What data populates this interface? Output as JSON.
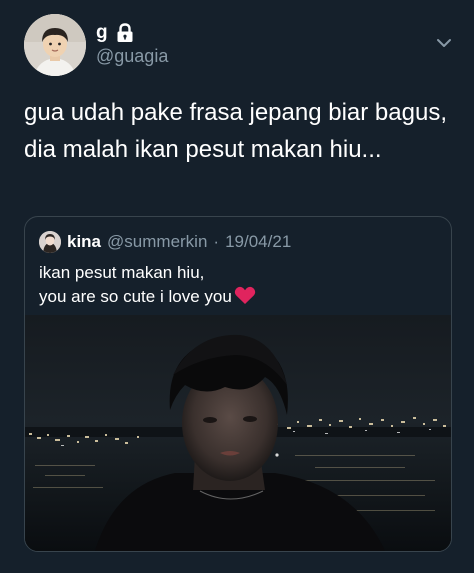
{
  "tweet": {
    "author": {
      "display_name": "g",
      "handle": "@guagia",
      "locked": true,
      "lock_icon": "lock-icon",
      "avatar_icon": "user-avatar"
    },
    "menu_icon": "chevron-down-icon",
    "text": "gua udah pake frasa jepang biar bagus, dia malah ikan pesut makan hiu...",
    "quoted_tweet": {
      "author": {
        "display_name": "kina",
        "handle": "@summerkin"
      },
      "separator": "·",
      "date": "19/04/21",
      "text_line1": "ikan pesut makan hiu,",
      "text_line2": "you are so cute i love you",
      "emoji": "heart-icon",
      "heart_color": "#e0245e"
    }
  },
  "colors": {
    "background": "#15202b",
    "secondary_text": "#8899a6",
    "border": "#38444d"
  }
}
